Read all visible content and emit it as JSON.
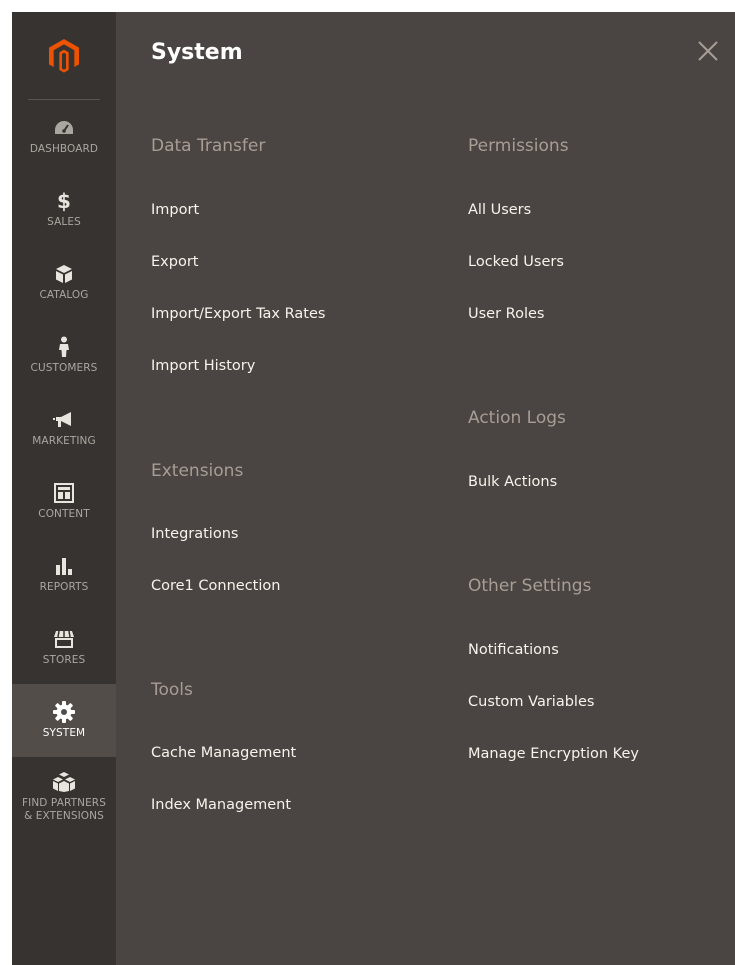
{
  "sidebar": {
    "logo_icon": "magento-logo-icon",
    "accent_color": "#eb5202",
    "items": [
      {
        "label": "DASHBOARD",
        "icon": "dashboard-gauge-icon"
      },
      {
        "label": "SALES",
        "icon": "dollar-icon"
      },
      {
        "label": "CATALOG",
        "icon": "box-icon"
      },
      {
        "label": "CUSTOMERS",
        "icon": "person-icon"
      },
      {
        "label": "MARKETING",
        "icon": "megaphone-icon"
      },
      {
        "label": "CONTENT",
        "icon": "layout-icon"
      },
      {
        "label": "REPORTS",
        "icon": "bar-chart-icon"
      },
      {
        "label": "STORES",
        "icon": "storefront-icon"
      },
      {
        "label": "SYSTEM",
        "icon": "gear-icon",
        "active": true
      },
      {
        "label": "FIND PARTNERS\n& EXTENSIONS",
        "icon": "cubes-icon"
      }
    ]
  },
  "panel": {
    "title": "System",
    "close_icon": "close-icon",
    "col1": [
      {
        "title": "Data Transfer",
        "links": [
          "Import",
          "Export",
          "Import/Export Tax Rates",
          "Import History"
        ]
      },
      {
        "title": "Extensions",
        "links": [
          "Integrations",
          "Core1 Connection"
        ]
      },
      {
        "title": "Tools",
        "links": [
          "Cache Management",
          "Index Management"
        ]
      }
    ],
    "col2": [
      {
        "title": "Permissions",
        "links": [
          "All Users",
          "Locked Users",
          "User Roles"
        ]
      },
      {
        "title": "Action Logs",
        "links": [
          "Bulk Actions"
        ]
      },
      {
        "title": "Other Settings",
        "links": [
          "Notifications",
          "Custom Variables",
          "Manage Encryption Key"
        ]
      }
    ]
  }
}
